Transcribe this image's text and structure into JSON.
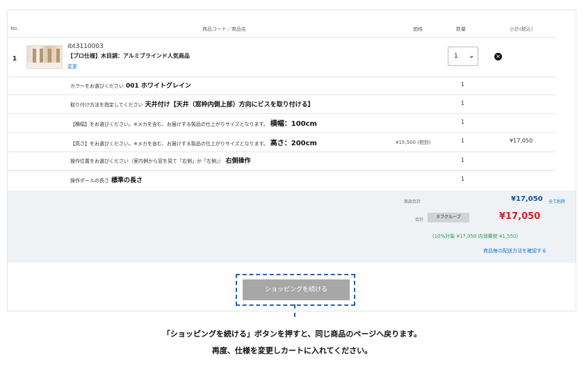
{
  "table": {
    "headers": {
      "no": "No.",
      "name": "商品コード／商品名",
      "price": "価格",
      "qty": "数量",
      "subtotal": "小計(税込)"
    }
  },
  "item": {
    "no": "1",
    "code": "ibt3110003",
    "name": "【プロ仕様】木目調：アルミブラインド人気商品",
    "change_link": "変更",
    "qty": "1",
    "delete_icon": "close-circle-icon"
  },
  "options": [
    {
      "label": "カラーをお選びください",
      "value": "001 ホワイトグレイン",
      "qty": "1",
      "price": "",
      "subtotal": ""
    },
    {
      "label": "取り付け方法を指定してください",
      "value": "天井付け【天井（窓枠内側上部）方向にビスを取り付ける】",
      "qty": "1",
      "price": "",
      "subtotal": ""
    },
    {
      "label": "【横幅】をお選びください。※メカを含む、お届けする製品の仕上がりサイズとなります。",
      "value": "横幅：100cm",
      "qty": "1",
      "price": "",
      "subtotal": ""
    },
    {
      "label": "【高さ】をお選びください。※メカを含む、お届けする製品の仕上がりサイズとなります。",
      "value": "高さ：200cm",
      "qty": "1",
      "price": "¥15,500 (税別)",
      "subtotal": "¥17,050"
    },
    {
      "label": "操作位置をお選びください（室内側から窓を見て「右側」か「左側」）",
      "value": "右側操作",
      "qty": "1",
      "price": "",
      "subtotal": ""
    },
    {
      "label": "操作ポールの長さ",
      "value": "標準の長さ",
      "qty": "1",
      "price": "",
      "subtotal": ""
    }
  ],
  "summary": {
    "subtotal_label": "商品合計",
    "subtotal_value": "¥17,050",
    "clear_all": "全て削除",
    "total_label": "合計",
    "tab_group": "タブグループ",
    "total_value": "¥17,050",
    "tax_note": "(10%対象 ¥17,050  内消費税 ¥1,550)",
    "shipping_link": "商品毎の配送方法を確認する"
  },
  "continue_button": "ショッピングを続ける",
  "annotation": {
    "line1": "「ショッピングを続ける」ボタンを押すと、同じ商品のページへ戻ります。",
    "line2": "再度、仕様を変更しカートに入れてください。"
  },
  "colors": {
    "link": "#1a73c8",
    "total": "#cc1f2a",
    "subtotal": "#1a4f9c",
    "tax": "#2a9b5a",
    "callout": "#2b5fa5"
  }
}
